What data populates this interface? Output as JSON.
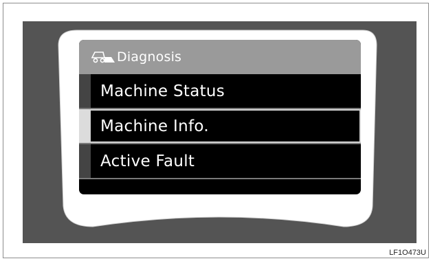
{
  "screen": {
    "header": {
      "title": "Diagnosis",
      "icon": "excavator-icon"
    },
    "menu": [
      {
        "label": "Machine Status",
        "selected": false
      },
      {
        "label": "Machine Info.",
        "selected": true
      },
      {
        "label": "Active Fault",
        "selected": false
      }
    ]
  },
  "figure_code": "LF1O473U",
  "colors": {
    "panel": "#545454",
    "bezel": "#ffffff",
    "header": "#9a9a9a",
    "screen": "#000000",
    "selection_border": "#d8d8d8"
  }
}
